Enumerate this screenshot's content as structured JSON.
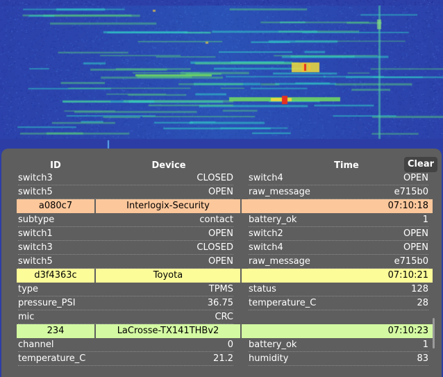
{
  "header": {
    "col_id": "ID",
    "col_device": "Device",
    "col_time": "Time",
    "clear_label": "Clear"
  },
  "rows": [
    {
      "kind": "field",
      "left_key": "switch3",
      "left_value": "CLOSED",
      "right_key": "switch4",
      "right_value": "OPEN"
    },
    {
      "kind": "field",
      "left_key": "switch5",
      "left_value": "OPEN",
      "right_key": "raw_message",
      "right_value": "e715b0"
    },
    {
      "kind": "event",
      "id": "a080c7",
      "device": "Interlogix-Security",
      "time": "07:10:18",
      "color": "#fcc79b"
    },
    {
      "kind": "field",
      "left_key": "subtype",
      "left_value": "contact",
      "right_key": "battery_ok",
      "right_value": "1"
    },
    {
      "kind": "field",
      "left_key": "switch1",
      "left_value": "OPEN",
      "right_key": "switch2",
      "right_value": "OPEN"
    },
    {
      "kind": "field",
      "left_key": "switch3",
      "left_value": "CLOSED",
      "right_key": "switch4",
      "right_value": "OPEN"
    },
    {
      "kind": "field",
      "left_key": "switch5",
      "left_value": "OPEN",
      "right_key": "raw_message",
      "right_value": "e715b0"
    },
    {
      "kind": "event",
      "id": "d3f4363c",
      "device": "Toyota",
      "time": "07:10:21",
      "color": "#fcfc99"
    },
    {
      "kind": "field",
      "left_key": "type",
      "left_value": "TPMS",
      "right_key": "status",
      "right_value": "128"
    },
    {
      "kind": "field",
      "left_key": "pressure_PSI",
      "left_value": "36.75",
      "right_key": "temperature_C",
      "right_value": "28"
    },
    {
      "kind": "field",
      "left_key": "mic",
      "left_value": "CRC",
      "right_key": "",
      "right_value": ""
    },
    {
      "kind": "event",
      "id": "234",
      "device": "LaCrosse-TX141THBv2",
      "time": "07:10:23",
      "color": "#d3f9a2"
    },
    {
      "kind": "field",
      "left_key": "channel",
      "left_value": "0",
      "right_key": "battery_ok",
      "right_value": "1"
    },
    {
      "kind": "field",
      "left_key": "temperature_C",
      "left_value": "21.2",
      "right_key": "humidity",
      "right_value": "83"
    }
  ],
  "colors": {
    "panel_bg": "#5e5e5e",
    "waterfall_bg": "#2c3ea6",
    "event_orange": "#fcc79b",
    "event_yellow": "#fcfc99",
    "event_green": "#d3f9a2"
  }
}
